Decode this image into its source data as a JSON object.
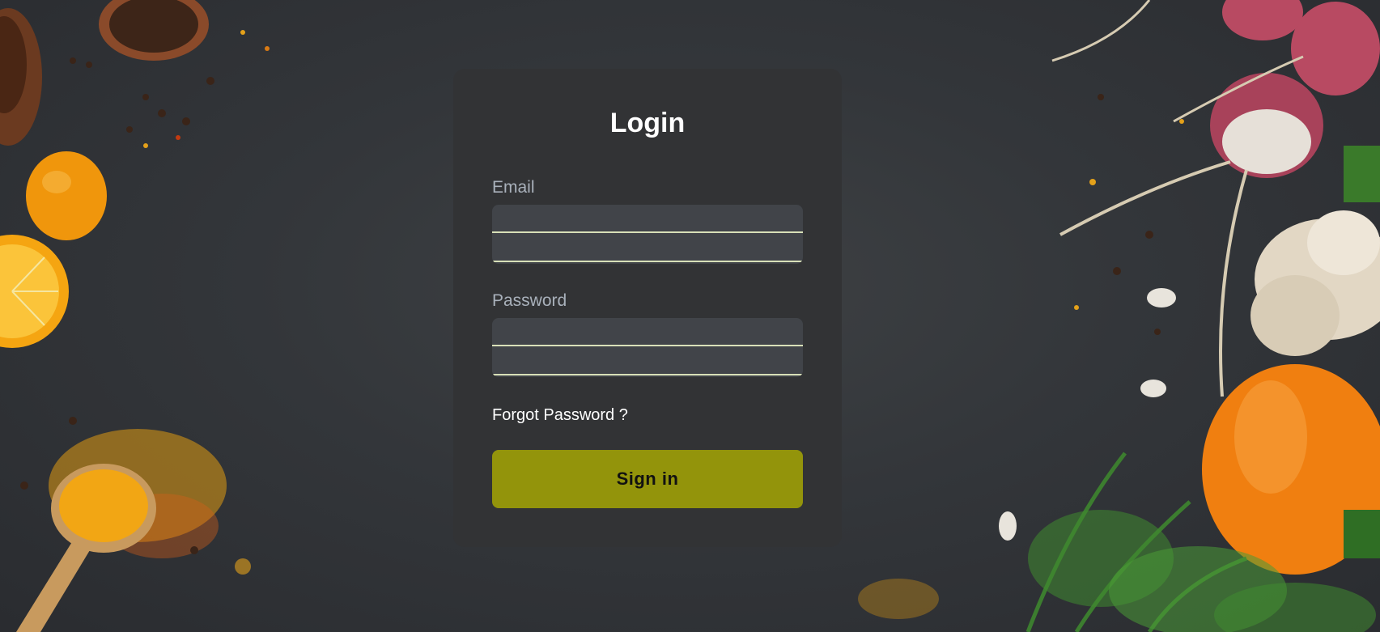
{
  "login": {
    "title": "Login",
    "email_label": "Email",
    "email_value": "",
    "password_label": "Password",
    "password_value": "",
    "forgot_link": "Forgot Password ?",
    "signin_label": "Sign in"
  },
  "colors": {
    "background": "#33363a",
    "card": "#323335",
    "input": "#414449",
    "input_underline": "#d8e0b8",
    "accent_button": "#93940b",
    "label": "#a9b1bb"
  },
  "decor": {
    "left_items": [
      "bowl",
      "pepper-spoon",
      "kumquat",
      "lemon-half",
      "turmeric-spoon",
      "spice-powder"
    ],
    "right_items": [
      "radishes",
      "garlic",
      "orange-bell-pepper",
      "dill"
    ]
  }
}
